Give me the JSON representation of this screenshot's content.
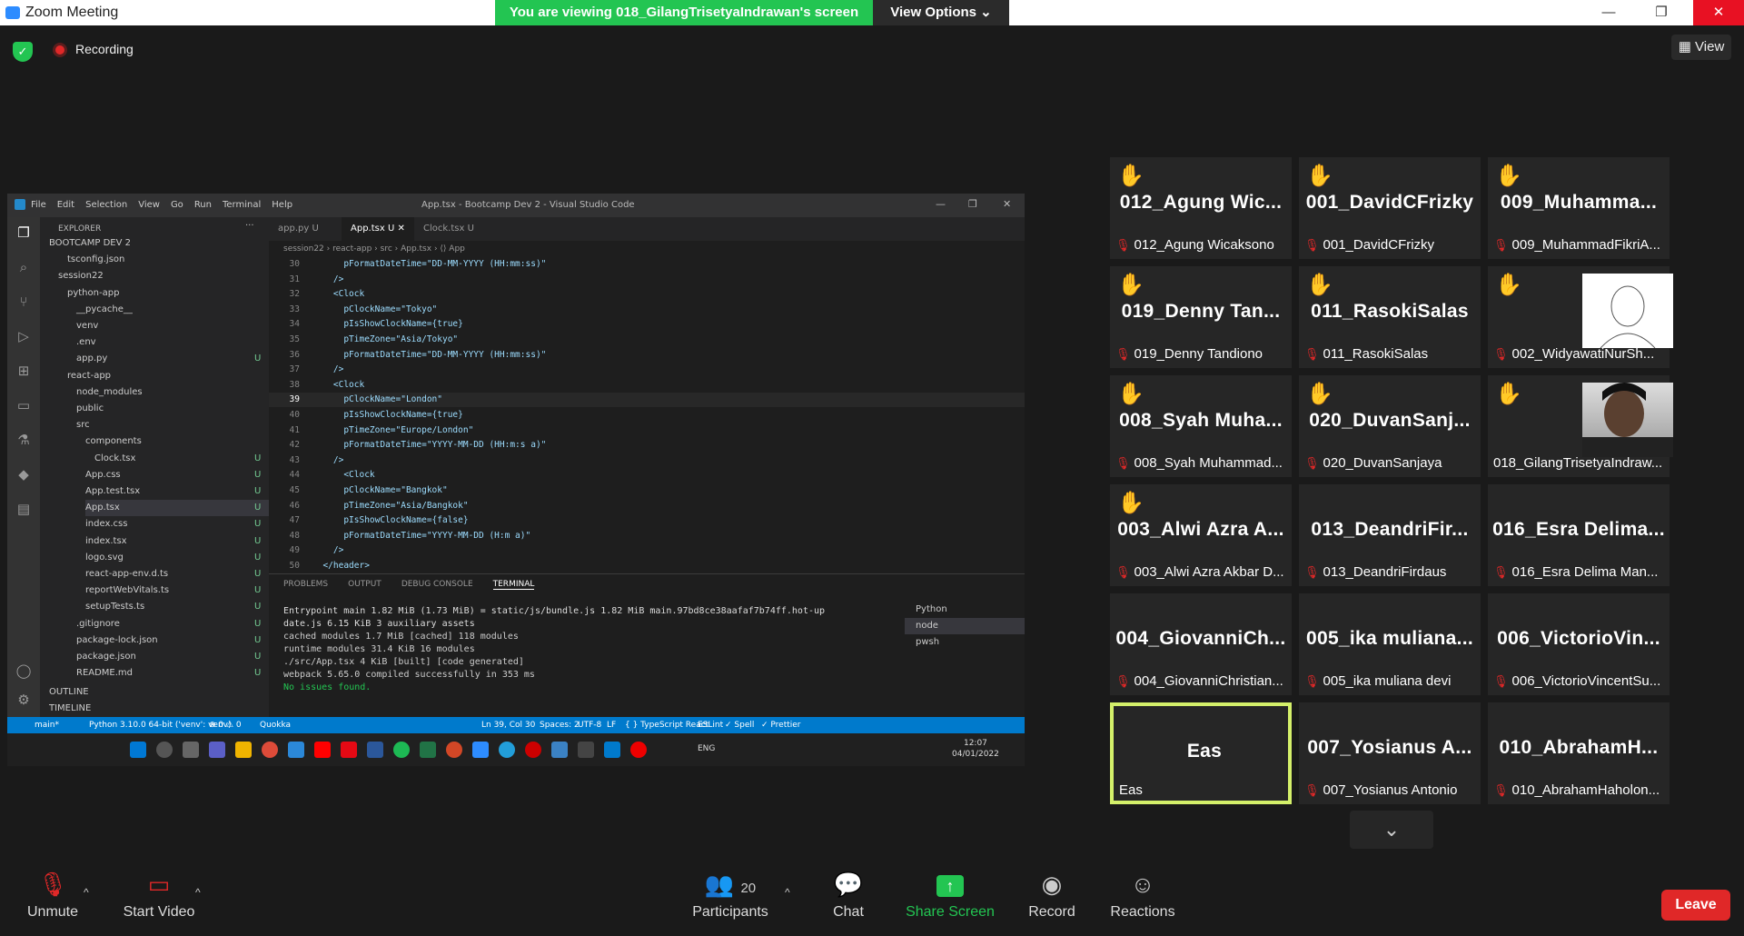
{
  "window": {
    "title": "Zoom Meeting"
  },
  "banner": {
    "text": "You are viewing 018_GilangTrisetyaIndrawan's screen",
    "view_options": "View Options ⌄"
  },
  "recording": {
    "label": "Recording"
  },
  "view_button": {
    "label": "View"
  },
  "vscode": {
    "menu": [
      "File",
      "Edit",
      "Selection",
      "View",
      "Go",
      "Run",
      "Terminal",
      "Help"
    ],
    "window_title": "App.tsx - Bootcamp Dev 2 - Visual Studio Code",
    "explorer": {
      "header": "EXPLORER",
      "items": [
        {
          "label": "BOOTCAMP DEV 2",
          "indent": 0,
          "u": ""
        },
        {
          "label": "tsconfig.json",
          "indent": 2,
          "u": ""
        },
        {
          "label": "session22",
          "indent": 1,
          "u": ""
        },
        {
          "label": "python-app",
          "indent": 2,
          "u": ""
        },
        {
          "label": "__pycache__",
          "indent": 3,
          "u": ""
        },
        {
          "label": "venv",
          "indent": 3,
          "u": ""
        },
        {
          "label": ".env",
          "indent": 3,
          "u": ""
        },
        {
          "label": "app.py",
          "indent": 3,
          "u": "U"
        },
        {
          "label": "react-app",
          "indent": 2,
          "u": ""
        },
        {
          "label": "node_modules",
          "indent": 3,
          "u": ""
        },
        {
          "label": "public",
          "indent": 3,
          "u": ""
        },
        {
          "label": "src",
          "indent": 3,
          "u": ""
        },
        {
          "label": "components",
          "indent": 4,
          "u": ""
        },
        {
          "label": "Clock.tsx",
          "indent": 5,
          "u": "U"
        },
        {
          "label": "App.css",
          "indent": 4,
          "u": "U"
        },
        {
          "label": "App.test.tsx",
          "indent": 4,
          "u": "U"
        },
        {
          "label": "App.tsx",
          "indent": 4,
          "u": "U"
        },
        {
          "label": "index.css",
          "indent": 4,
          "u": "U"
        },
        {
          "label": "index.tsx",
          "indent": 4,
          "u": "U"
        },
        {
          "label": "logo.svg",
          "indent": 4,
          "u": "U"
        },
        {
          "label": "react-app-env.d.ts",
          "indent": 4,
          "u": "U"
        },
        {
          "label": "reportWebVitals.ts",
          "indent": 4,
          "u": "U"
        },
        {
          "label": "setupTests.ts",
          "indent": 4,
          "u": "U"
        },
        {
          "label": ".gitignore",
          "indent": 3,
          "u": "U"
        },
        {
          "label": "package-lock.json",
          "indent": 3,
          "u": "U"
        },
        {
          "label": "package.json",
          "indent": 3,
          "u": "U"
        },
        {
          "label": "README.md",
          "indent": 3,
          "u": "U"
        },
        {
          "label": "OUTLINE",
          "indent": 0,
          "u": ""
        },
        {
          "label": "TIMELINE",
          "indent": 0,
          "u": ""
        }
      ]
    },
    "tabs": [
      "app.py  U",
      "App.tsx  U  ✕",
      "Clock.tsx  U"
    ],
    "breadcrumb": "session22 › react-app › src › App.tsx › ⟨⟩ App",
    "code_lines": [
      {
        "n": "30",
        "t": "      pFormatDateTime=\"DD-MM-YYYY (HH:mm:ss)\""
      },
      {
        "n": "31",
        "t": "    />"
      },
      {
        "n": "32",
        "t": "    <Clock"
      },
      {
        "n": "33",
        "t": "      pClockName=\"Tokyo\""
      },
      {
        "n": "34",
        "t": "      pIsShowClockName={true}"
      },
      {
        "n": "35",
        "t": "      pTimeZone=\"Asia/Tokyo\""
      },
      {
        "n": "36",
        "t": "      pFormatDateTime=\"DD-MM-YYYY (HH:mm:ss)\""
      },
      {
        "n": "37",
        "t": "    />"
      },
      {
        "n": "38",
        "t": "    <Clock"
      },
      {
        "n": "39",
        "t": "      pClockName=\"London\""
      },
      {
        "n": "40",
        "t": "      pIsShowClockName={true}"
      },
      {
        "n": "41",
        "t": "      pTimeZone=\"Europe/London\""
      },
      {
        "n": "42",
        "t": "      pFormatDateTime=\"YYYY-MM-DD (HH:m:s a)\""
      },
      {
        "n": "43",
        "t": "    />"
      },
      {
        "n": "44",
        "t": "      <Clock"
      },
      {
        "n": "45",
        "t": "      pClockName=\"Bangkok\""
      },
      {
        "n": "46",
        "t": "      pTimeZone=\"Asia/Bangkok\""
      },
      {
        "n": "47",
        "t": "      pIsShowClockName={false}"
      },
      {
        "n": "48",
        "t": "      pFormatDateTime=\"YYYY-MM-DD (H:m a)\""
      },
      {
        "n": "49",
        "t": "    />"
      },
      {
        "n": "50",
        "t": "  </header>"
      }
    ],
    "panel_tabs": [
      "PROBLEMS",
      "OUTPUT",
      "DEBUG CONSOLE",
      "TERMINAL"
    ],
    "terminal_lines": [
      "Entrypoint main 1.82 MiB (1.73 MiB) = static/js/bundle.js 1.82 MiB main.97bd8ce38aafaf7b74ff.hot-up",
      "date.js 6.15 KiB 3 auxiliary assets",
      "cached modules 1.7 MiB [cached] 118 modules",
      "runtime modules 31.4 KiB 16 modules",
      "./src/App.tsx 4 KiB [built] [code generated]",
      "webpack 5.65.0 compiled successfully in 353 ms",
      "No issues found."
    ],
    "shells": [
      "Python",
      "node",
      "pwsh"
    ],
    "status": {
      "branch": "main*",
      "python": "Python 3.10.0 64-bit ('venv': venv)",
      "problems": "⊗ 0 ⚠ 0",
      "quokka": "Quokka",
      "pos": "Ln 39, Col 30",
      "spaces": "Spaces: 2",
      "enc": "UTF-8",
      "eol": "LF",
      "lang": "{ } TypeScript React",
      "eslint": "ESLint",
      "spell": "✓ Spell",
      "prettier": "✓ Prettier"
    },
    "taskbar": {
      "lang": "ENG",
      "time": "12:07",
      "date": "04/01/2022"
    }
  },
  "participants": [
    {
      "big": "012_Agung Wic...",
      "name": "012_Agung Wicaksono",
      "hand": true,
      "photo": false,
      "muted": true
    },
    {
      "big": "001_DavidCFrizky",
      "name": "001_DavidCFrizky",
      "hand": true,
      "photo": false,
      "muted": true
    },
    {
      "big": "009_Muhamma...",
      "name": "009_MuhammadFikriA...",
      "hand": true,
      "photo": false,
      "muted": true
    },
    {
      "big": "019_Denny Tan...",
      "name": "019_Denny Tandiono",
      "hand": true,
      "photo": false,
      "muted": true
    },
    {
      "big": "011_RasokiSalas",
      "name": "011_RasokiSalas",
      "hand": true,
      "photo": false,
      "muted": true
    },
    {
      "big": "",
      "name": "002_WidyawatiNurSh...",
      "hand": true,
      "photo": "sketch",
      "muted": true
    },
    {
      "big": "008_Syah Muha...",
      "name": "008_Syah Muhammad...",
      "hand": true,
      "photo": false,
      "muted": true
    },
    {
      "big": "020_DuvanSanj...",
      "name": "020_DuvanSanjaya",
      "hand": true,
      "photo": false,
      "muted": true
    },
    {
      "big": "",
      "name": "018_GilangTrisetyaIndraw...",
      "hand": true,
      "photo": "face",
      "muted": false
    },
    {
      "big": "003_Alwi Azra A...",
      "name": "003_Alwi Azra Akbar D...",
      "hand": true,
      "photo": false,
      "muted": true
    },
    {
      "big": "013_DeandriFir...",
      "name": "013_DeandriFirdaus",
      "hand": false,
      "photo": false,
      "muted": true
    },
    {
      "big": "016_Esra  Delima...",
      "name": "016_Esra Delima Man...",
      "hand": false,
      "photo": false,
      "muted": true
    },
    {
      "big": "004_GiovanniCh...",
      "name": "004_GiovanniChristian...",
      "hand": false,
      "photo": false,
      "muted": true
    },
    {
      "big": "005_ika muliana...",
      "name": "005_ika muliana devi",
      "hand": false,
      "photo": false,
      "muted": true
    },
    {
      "big": "006_VictorioVin...",
      "name": "006_VictorioVincentSu...",
      "hand": false,
      "photo": false,
      "muted": true
    },
    {
      "big": "Eas",
      "name": "Eas",
      "hand": false,
      "photo": false,
      "muted": false
    },
    {
      "big": "007_Yosianus A...",
      "name": "007_Yosianus Antonio",
      "hand": false,
      "photo": false,
      "muted": true
    },
    {
      "big": "010_AbrahamH...",
      "name": "010_AbrahamHaholon...",
      "hand": false,
      "photo": false,
      "muted": true
    }
  ],
  "toolbar": {
    "unmute": "Unmute",
    "start_video": "Start Video",
    "participants_count": "20",
    "participants": "Participants",
    "chat": "Chat",
    "share_screen": "Share Screen",
    "record": "Record",
    "reactions": "Reactions",
    "leave": "Leave"
  },
  "colors": {
    "accent_green": "#23c552",
    "leave_red": "#e02828",
    "active_speaker": "#d4f06a",
    "vscode_blue": "#007acc"
  }
}
